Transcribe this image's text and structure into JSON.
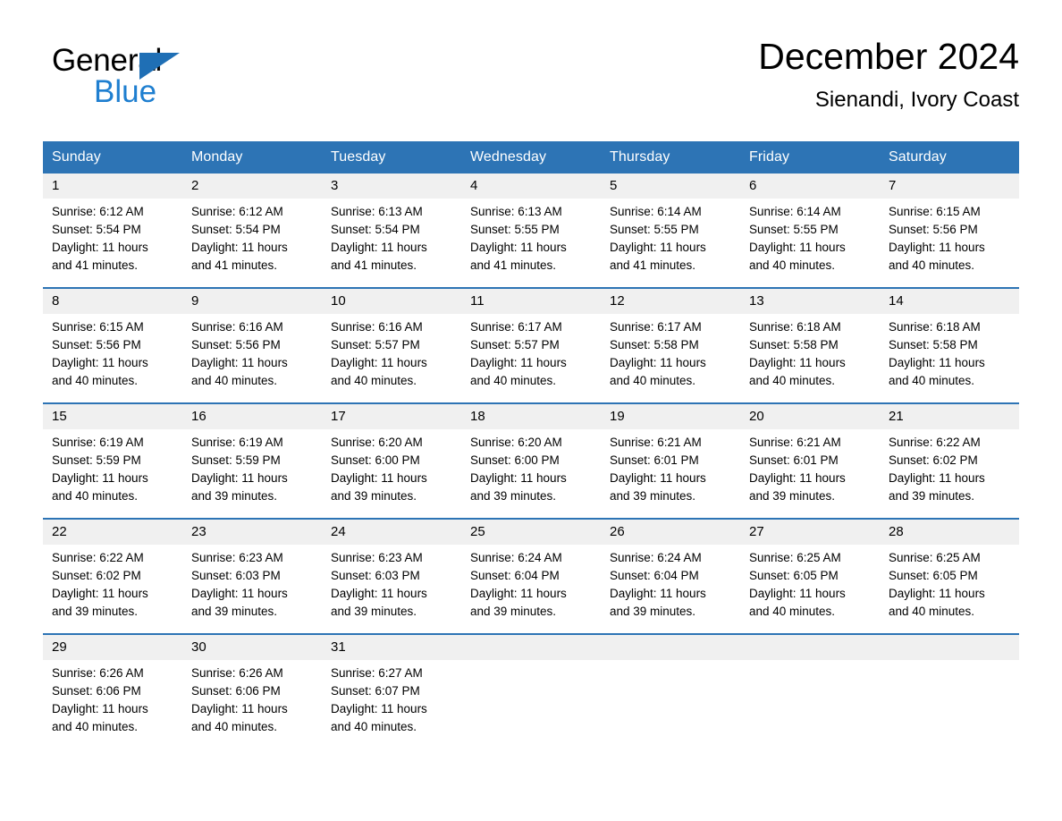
{
  "brand": {
    "name_part1": "General",
    "name_part2": "Blue",
    "triangle_color": "#1f6fb5",
    "blue_color": "#1f7fd0"
  },
  "header": {
    "month_title": "December 2024",
    "location": "Sienandi, Ivory Coast",
    "header_bg": "#2d74b5",
    "daynum_bg": "#f0f0f0"
  },
  "weekdays": [
    "Sunday",
    "Monday",
    "Tuesday",
    "Wednesday",
    "Thursday",
    "Friday",
    "Saturday"
  ],
  "weeks": [
    {
      "days": [
        {
          "num": "1",
          "sunrise": "Sunrise: 6:12 AM",
          "sunset": "Sunset: 5:54 PM",
          "daylight1": "Daylight: 11 hours",
          "daylight2": "and 41 minutes."
        },
        {
          "num": "2",
          "sunrise": "Sunrise: 6:12 AM",
          "sunset": "Sunset: 5:54 PM",
          "daylight1": "Daylight: 11 hours",
          "daylight2": "and 41 minutes."
        },
        {
          "num": "3",
          "sunrise": "Sunrise: 6:13 AM",
          "sunset": "Sunset: 5:54 PM",
          "daylight1": "Daylight: 11 hours",
          "daylight2": "and 41 minutes."
        },
        {
          "num": "4",
          "sunrise": "Sunrise: 6:13 AM",
          "sunset": "Sunset: 5:55 PM",
          "daylight1": "Daylight: 11 hours",
          "daylight2": "and 41 minutes."
        },
        {
          "num": "5",
          "sunrise": "Sunrise: 6:14 AM",
          "sunset": "Sunset: 5:55 PM",
          "daylight1": "Daylight: 11 hours",
          "daylight2": "and 41 minutes."
        },
        {
          "num": "6",
          "sunrise": "Sunrise: 6:14 AM",
          "sunset": "Sunset: 5:55 PM",
          "daylight1": "Daylight: 11 hours",
          "daylight2": "and 40 minutes."
        },
        {
          "num": "7",
          "sunrise": "Sunrise: 6:15 AM",
          "sunset": "Sunset: 5:56 PM",
          "daylight1": "Daylight: 11 hours",
          "daylight2": "and 40 minutes."
        }
      ]
    },
    {
      "days": [
        {
          "num": "8",
          "sunrise": "Sunrise: 6:15 AM",
          "sunset": "Sunset: 5:56 PM",
          "daylight1": "Daylight: 11 hours",
          "daylight2": "and 40 minutes."
        },
        {
          "num": "9",
          "sunrise": "Sunrise: 6:16 AM",
          "sunset": "Sunset: 5:56 PM",
          "daylight1": "Daylight: 11 hours",
          "daylight2": "and 40 minutes."
        },
        {
          "num": "10",
          "sunrise": "Sunrise: 6:16 AM",
          "sunset": "Sunset: 5:57 PM",
          "daylight1": "Daylight: 11 hours",
          "daylight2": "and 40 minutes."
        },
        {
          "num": "11",
          "sunrise": "Sunrise: 6:17 AM",
          "sunset": "Sunset: 5:57 PM",
          "daylight1": "Daylight: 11 hours",
          "daylight2": "and 40 minutes."
        },
        {
          "num": "12",
          "sunrise": "Sunrise: 6:17 AM",
          "sunset": "Sunset: 5:58 PM",
          "daylight1": "Daylight: 11 hours",
          "daylight2": "and 40 minutes."
        },
        {
          "num": "13",
          "sunrise": "Sunrise: 6:18 AM",
          "sunset": "Sunset: 5:58 PM",
          "daylight1": "Daylight: 11 hours",
          "daylight2": "and 40 minutes."
        },
        {
          "num": "14",
          "sunrise": "Sunrise: 6:18 AM",
          "sunset": "Sunset: 5:58 PM",
          "daylight1": "Daylight: 11 hours",
          "daylight2": "and 40 minutes."
        }
      ]
    },
    {
      "days": [
        {
          "num": "15",
          "sunrise": "Sunrise: 6:19 AM",
          "sunset": "Sunset: 5:59 PM",
          "daylight1": "Daylight: 11 hours",
          "daylight2": "and 40 minutes."
        },
        {
          "num": "16",
          "sunrise": "Sunrise: 6:19 AM",
          "sunset": "Sunset: 5:59 PM",
          "daylight1": "Daylight: 11 hours",
          "daylight2": "and 39 minutes."
        },
        {
          "num": "17",
          "sunrise": "Sunrise: 6:20 AM",
          "sunset": "Sunset: 6:00 PM",
          "daylight1": "Daylight: 11 hours",
          "daylight2": "and 39 minutes."
        },
        {
          "num": "18",
          "sunrise": "Sunrise: 6:20 AM",
          "sunset": "Sunset: 6:00 PM",
          "daylight1": "Daylight: 11 hours",
          "daylight2": "and 39 minutes."
        },
        {
          "num": "19",
          "sunrise": "Sunrise: 6:21 AM",
          "sunset": "Sunset: 6:01 PM",
          "daylight1": "Daylight: 11 hours",
          "daylight2": "and 39 minutes."
        },
        {
          "num": "20",
          "sunrise": "Sunrise: 6:21 AM",
          "sunset": "Sunset: 6:01 PM",
          "daylight1": "Daylight: 11 hours",
          "daylight2": "and 39 minutes."
        },
        {
          "num": "21",
          "sunrise": "Sunrise: 6:22 AM",
          "sunset": "Sunset: 6:02 PM",
          "daylight1": "Daylight: 11 hours",
          "daylight2": "and 39 minutes."
        }
      ]
    },
    {
      "days": [
        {
          "num": "22",
          "sunrise": "Sunrise: 6:22 AM",
          "sunset": "Sunset: 6:02 PM",
          "daylight1": "Daylight: 11 hours",
          "daylight2": "and 39 minutes."
        },
        {
          "num": "23",
          "sunrise": "Sunrise: 6:23 AM",
          "sunset": "Sunset: 6:03 PM",
          "daylight1": "Daylight: 11 hours",
          "daylight2": "and 39 minutes."
        },
        {
          "num": "24",
          "sunrise": "Sunrise: 6:23 AM",
          "sunset": "Sunset: 6:03 PM",
          "daylight1": "Daylight: 11 hours",
          "daylight2": "and 39 minutes."
        },
        {
          "num": "25",
          "sunrise": "Sunrise: 6:24 AM",
          "sunset": "Sunset: 6:04 PM",
          "daylight1": "Daylight: 11 hours",
          "daylight2": "and 39 minutes."
        },
        {
          "num": "26",
          "sunrise": "Sunrise: 6:24 AM",
          "sunset": "Sunset: 6:04 PM",
          "daylight1": "Daylight: 11 hours",
          "daylight2": "and 39 minutes."
        },
        {
          "num": "27",
          "sunrise": "Sunrise: 6:25 AM",
          "sunset": "Sunset: 6:05 PM",
          "daylight1": "Daylight: 11 hours",
          "daylight2": "and 40 minutes."
        },
        {
          "num": "28",
          "sunrise": "Sunrise: 6:25 AM",
          "sunset": "Sunset: 6:05 PM",
          "daylight1": "Daylight: 11 hours",
          "daylight2": "and 40 minutes."
        }
      ]
    },
    {
      "days": [
        {
          "num": "29",
          "sunrise": "Sunrise: 6:26 AM",
          "sunset": "Sunset: 6:06 PM",
          "daylight1": "Daylight: 11 hours",
          "daylight2": "and 40 minutes."
        },
        {
          "num": "30",
          "sunrise": "Sunrise: 6:26 AM",
          "sunset": "Sunset: 6:06 PM",
          "daylight1": "Daylight: 11 hours",
          "daylight2": "and 40 minutes."
        },
        {
          "num": "31",
          "sunrise": "Sunrise: 6:27 AM",
          "sunset": "Sunset: 6:07 PM",
          "daylight1": "Daylight: 11 hours",
          "daylight2": "and 40 minutes."
        },
        {
          "num": "",
          "sunrise": "",
          "sunset": "",
          "daylight1": "",
          "daylight2": ""
        },
        {
          "num": "",
          "sunrise": "",
          "sunset": "",
          "daylight1": "",
          "daylight2": ""
        },
        {
          "num": "",
          "sunrise": "",
          "sunset": "",
          "daylight1": "",
          "daylight2": ""
        },
        {
          "num": "",
          "sunrise": "",
          "sunset": "",
          "daylight1": "",
          "daylight2": ""
        }
      ]
    }
  ]
}
